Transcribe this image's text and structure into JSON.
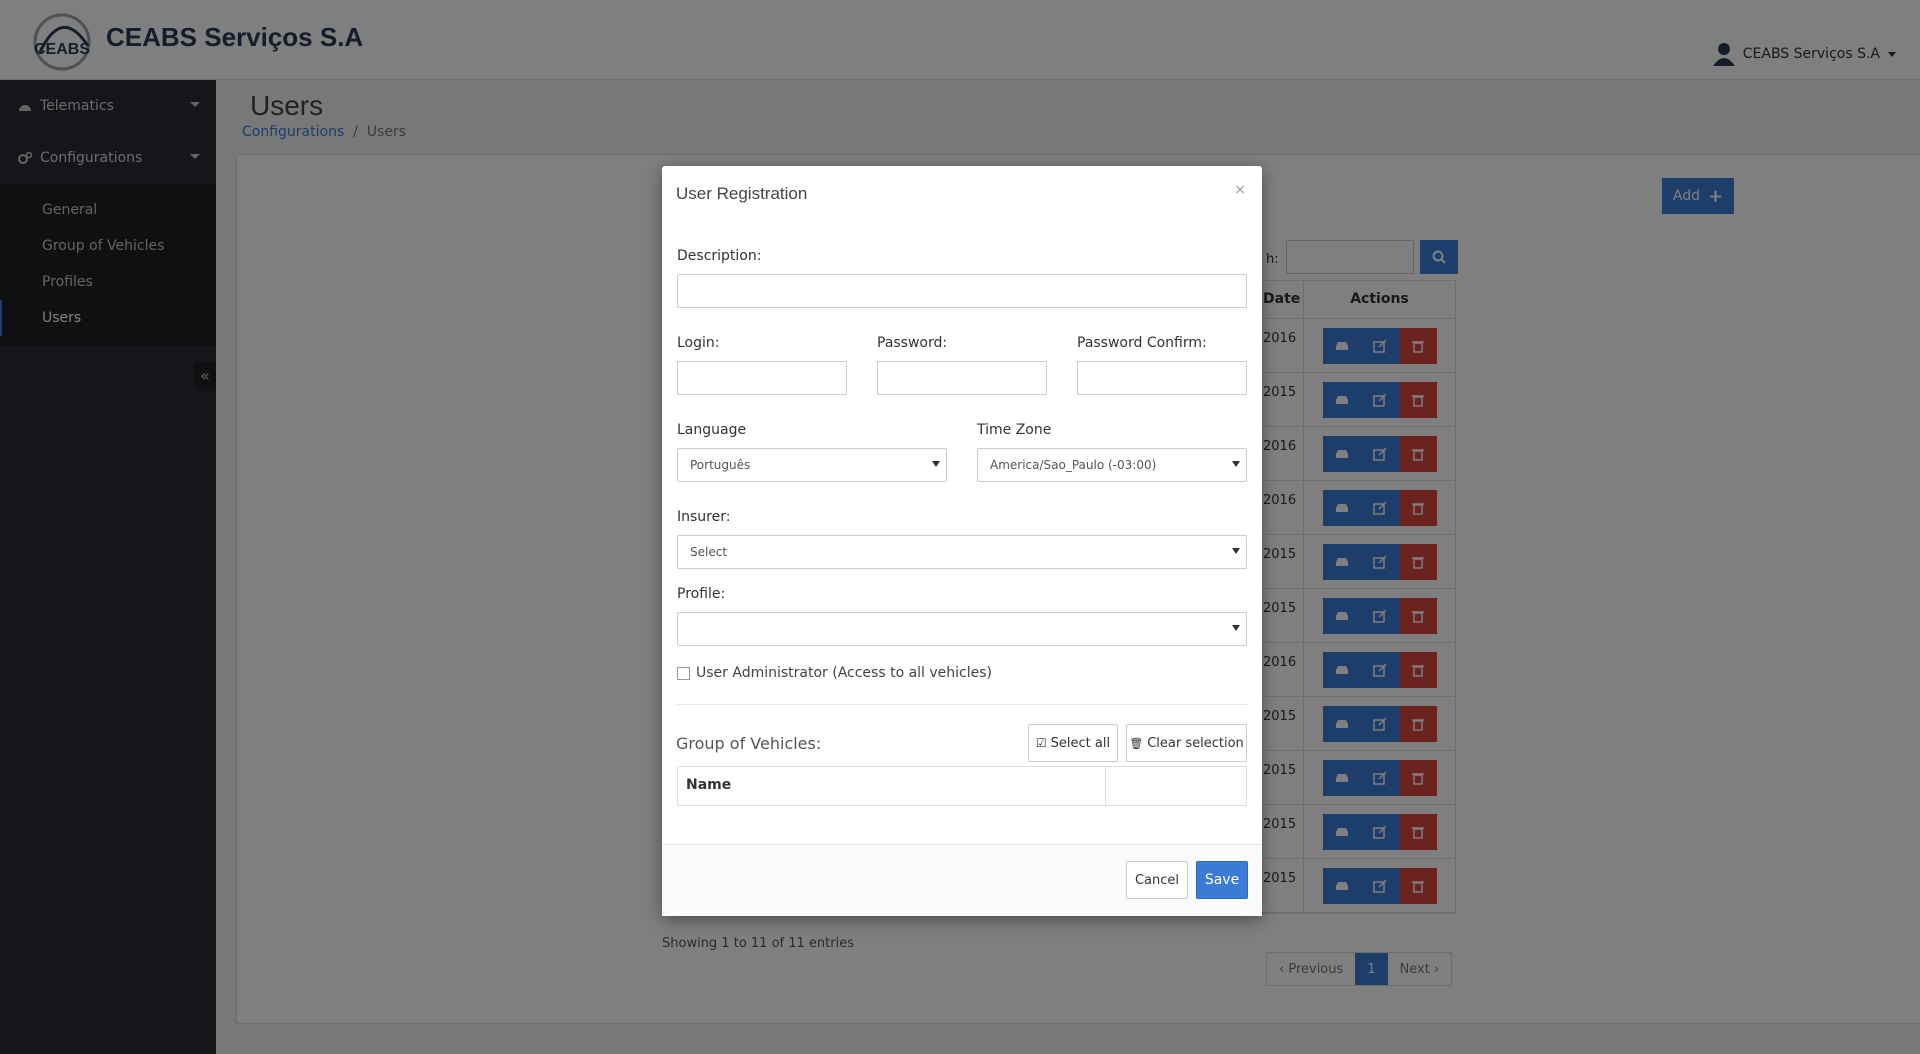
{
  "app": {
    "title": "CEABS Serviços S.A",
    "logo_text": "CEABS",
    "user_name": "CEABS Serviços S.A"
  },
  "sidebar": {
    "items": [
      {
        "label": "Telematics",
        "icon": "dashboard-icon"
      },
      {
        "label": "Configurations",
        "icon": "cogs-icon"
      }
    ],
    "sub_items": [
      {
        "label": "General"
      },
      {
        "label": "Group of Vehicles"
      },
      {
        "label": "Profiles"
      },
      {
        "label": "Users",
        "active": true
      }
    ]
  },
  "page": {
    "title": "Users",
    "breadcrumb": {
      "parent": "Configurations",
      "separator": "/",
      "current": "Users"
    },
    "add_label": "Add",
    "search_label": "h:",
    "table": {
      "headers": {
        "date": "Date",
        "actions": "Actions"
      },
      "rows": [
        "2016",
        "2015",
        "2016",
        "2016",
        "2015",
        "2015",
        "2016",
        "2015",
        "2015",
        "2015",
        "2015"
      ]
    },
    "showing": "Showing 1 to 11 of 11 entries",
    "pager": {
      "previous": "‹ Previous",
      "current": "1",
      "next": "Next ›"
    }
  },
  "modal": {
    "title": "User Registration",
    "close": "×",
    "description_label": "Description:",
    "description_value": "",
    "login_label": "Login:",
    "password_label": "Password:",
    "password_confirm_label": "Password Confirm:",
    "language_label": "Language",
    "language_value": "Português",
    "timezone_label": "Time Zone",
    "timezone_value": "America/Sao_Paulo (-03:00)",
    "insurer_label": "Insurer:",
    "insurer_value": "Select",
    "profile_label": "Profile:",
    "profile_value": "",
    "admin_label": "User Administrator (Access to all vehicles)",
    "group_title": "Group of Vehicles:",
    "select_all": "Select all",
    "clear_selection": "Clear selection",
    "name_header": "Name",
    "cancel": "Cancel",
    "save": "Save"
  },
  "colors": {
    "primary": "#3a7bd5",
    "danger": "#d9473f",
    "sidebar": "#2a2d33"
  }
}
